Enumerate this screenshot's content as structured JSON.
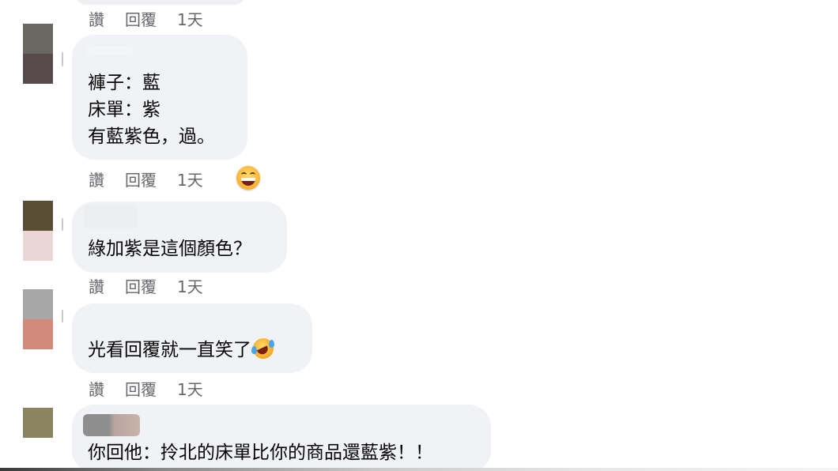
{
  "actions": {
    "like": "讚",
    "reply": "回覆",
    "time": "1天"
  },
  "comments": [
    {
      "lines": [
        "褲子：藍",
        "床單：紫",
        "有藍紫色，過。"
      ],
      "reaction_icon": "grinning-face-emoji"
    },
    {
      "lines": [
        "綠加紫是這個顏色？"
      ]
    },
    {
      "lines": [
        "光看回覆就一直笑了"
      ],
      "inline_icon": "rolling-on-floor-laughing-emoji"
    },
    {
      "lines": [
        "你回他：拎北的床單比你的商品還藍紫！！"
      ]
    }
  ],
  "colors": {
    "bubble_bg": "#f0f2f5",
    "meta_text": "#65676b",
    "text": "#050505"
  }
}
